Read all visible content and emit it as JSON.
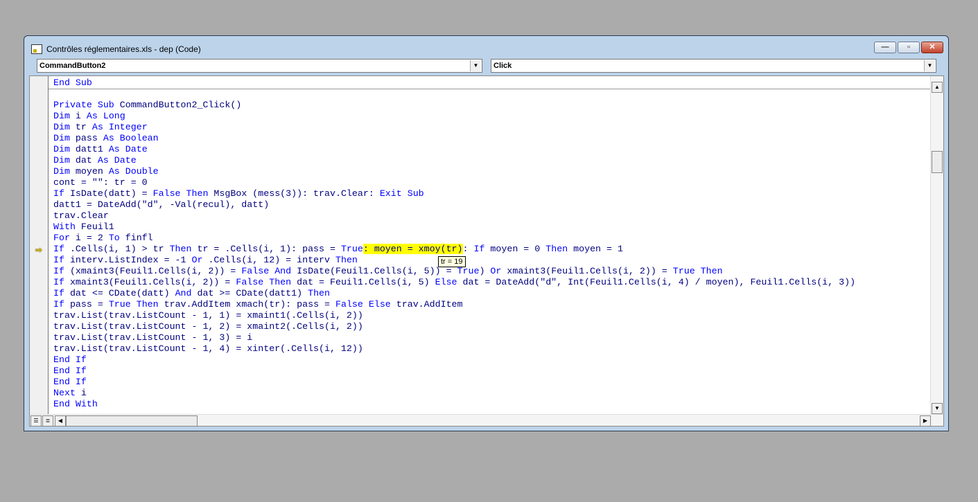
{
  "window": {
    "title": "Contrôles réglementaires.xls - dep (Code)",
    "buttons": {
      "minimize": "—",
      "maximize": "▫",
      "close": "✕"
    }
  },
  "object_combo": {
    "value": "CommandButton2"
  },
  "procedure_combo": {
    "value": "Click"
  },
  "tooltip": "tr = 19",
  "colors": {
    "keyword": "#0000ff",
    "text": "#00007f",
    "highlight": "#ffff00",
    "execution_arrow": "#e0c000"
  },
  "code_lines": [
    [
      [
        "End Sub",
        "k"
      ]
    ],
    [],
    [
      [
        "Private Sub",
        "k"
      ],
      [
        " CommandButton2_Click()",
        "t"
      ]
    ],
    [
      [
        "Dim",
        "k"
      ],
      [
        " i ",
        "t"
      ],
      [
        "As Long",
        "k"
      ]
    ],
    [
      [
        "Dim",
        "k"
      ],
      [
        " tr ",
        "t"
      ],
      [
        "As Integer",
        "k"
      ]
    ],
    [
      [
        "Dim",
        "k"
      ],
      [
        " pass ",
        "t"
      ],
      [
        "As Boolean",
        "k"
      ]
    ],
    [
      [
        "Dim",
        "k"
      ],
      [
        " datt1 ",
        "t"
      ],
      [
        "As Date",
        "k"
      ]
    ],
    [
      [
        "Dim",
        "k"
      ],
      [
        " dat ",
        "t"
      ],
      [
        "As Date",
        "k"
      ]
    ],
    [
      [
        "Dim",
        "k"
      ],
      [
        " moyen ",
        "t"
      ],
      [
        "As Double",
        "k"
      ]
    ],
    [
      [
        "cont = \"\": tr = 0",
        "t"
      ]
    ],
    [
      [
        "If",
        "k"
      ],
      [
        " IsDate(datt) = ",
        "t"
      ],
      [
        "False Then",
        "k"
      ],
      [
        " MsgBox (mess(3)): trav.Clear: ",
        "t"
      ],
      [
        "Exit Sub",
        "k"
      ]
    ],
    [
      [
        "datt1 = DateAdd(\"d\", -Val(recul), datt)",
        "t"
      ]
    ],
    [
      [
        "trav.Clear",
        "t"
      ]
    ],
    [
      [
        "With",
        "k"
      ],
      [
        " Feuil1",
        "t"
      ]
    ],
    [
      [
        "For",
        "k"
      ],
      [
        " i = 2 ",
        "t"
      ],
      [
        "To",
        "k"
      ],
      [
        " finfl",
        "t"
      ]
    ],
    [
      [
        "If",
        "k"
      ],
      [
        " .Cells(i, 1) > tr ",
        "t"
      ],
      [
        "Then",
        "k"
      ],
      [
        " tr = .Cells(i, 1): pass = ",
        "t"
      ],
      [
        "True",
        "k"
      ],
      [
        ": moyen = xmoy(tr)",
        "h"
      ],
      [
        ": ",
        "t"
      ],
      [
        "If",
        "k"
      ],
      [
        " moyen = 0 ",
        "t"
      ],
      [
        "Then",
        "k"
      ],
      [
        " moyen = 1",
        "t"
      ]
    ],
    [
      [
        "If",
        "k"
      ],
      [
        " interv.ListIndex = -1 ",
        "t"
      ],
      [
        "Or",
        "k"
      ],
      [
        " .Cells(i, 12) = interv ",
        "t"
      ],
      [
        "Then",
        "k"
      ]
    ],
    [
      [
        "If",
        "k"
      ],
      [
        " (xmaint3(Feuil1.Cells(i, 2)) = ",
        "t"
      ],
      [
        "False And",
        "k"
      ],
      [
        " IsDate(Feuil1.Cells(i, 5)) = ",
        "t"
      ],
      [
        "True",
        "k"
      ],
      [
        ") ",
        "t"
      ],
      [
        "Or",
        "k"
      ],
      [
        " xmaint3(Feuil1.Cells(i, 2)) = ",
        "t"
      ],
      [
        "True Then",
        "k"
      ]
    ],
    [
      [
        "If",
        "k"
      ],
      [
        " xmaint3(Feuil1.Cells(i, 2)) = ",
        "t"
      ],
      [
        "False Then",
        "k"
      ],
      [
        " dat = Feuil1.Cells(i, 5) ",
        "t"
      ],
      [
        "Else",
        "k"
      ],
      [
        " dat = DateAdd(\"d\", Int(Feuil1.Cells(i, 4) / moyen), Feuil1.Cells(i, 3))",
        "t"
      ]
    ],
    [
      [
        "If",
        "k"
      ],
      [
        " dat <= CDate(datt) ",
        "t"
      ],
      [
        "And",
        "k"
      ],
      [
        " dat >= CDate(datt1) ",
        "t"
      ],
      [
        "Then",
        "k"
      ]
    ],
    [
      [
        "If",
        "k"
      ],
      [
        " pass = ",
        "t"
      ],
      [
        "True Then",
        "k"
      ],
      [
        " trav.AddItem xmach(tr): pass = ",
        "t"
      ],
      [
        "False Else",
        "k"
      ],
      [
        " trav.AddItem",
        "t"
      ]
    ],
    [
      [
        "trav.List(trav.ListCount - 1, 1) = xmaint1(.Cells(i, 2))",
        "t"
      ]
    ],
    [
      [
        "trav.List(trav.ListCount - 1, 2) = xmaint2(.Cells(i, 2))",
        "t"
      ]
    ],
    [
      [
        "trav.List(trav.ListCount - 1, 3) = i",
        "t"
      ]
    ],
    [
      [
        "trav.List(trav.ListCount - 1, 4) = xinter(.Cells(i, 12))",
        "t"
      ]
    ],
    [
      [
        "End If",
        "k"
      ]
    ],
    [
      [
        "End If",
        "k"
      ]
    ],
    [
      [
        "End If",
        "k"
      ]
    ],
    [
      [
        "Next",
        "k"
      ],
      [
        " i",
        "t"
      ]
    ],
    [
      [
        "End With",
        "k"
      ]
    ]
  ]
}
